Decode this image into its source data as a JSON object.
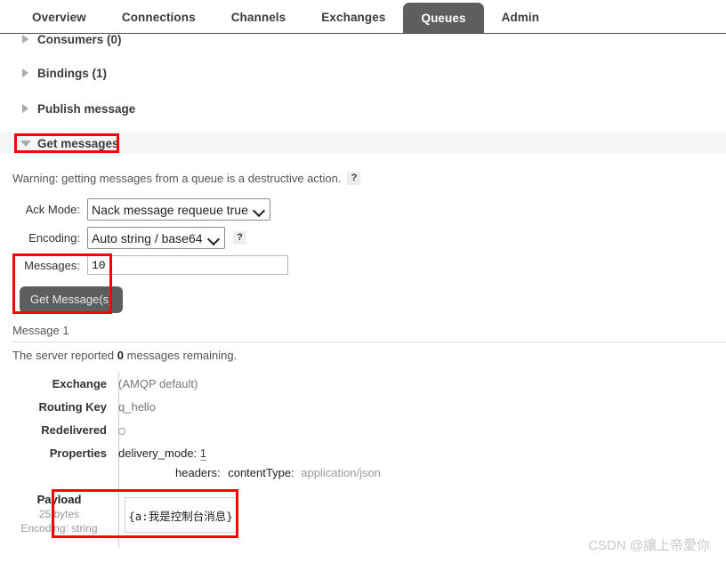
{
  "nav": {
    "tabs": [
      {
        "label": "Overview",
        "active": false
      },
      {
        "label": "Connections",
        "active": false
      },
      {
        "label": "Channels",
        "active": false
      },
      {
        "label": "Exchanges",
        "active": false
      },
      {
        "label": "Queues",
        "active": true
      },
      {
        "label": "Admin",
        "active": false
      }
    ],
    "active_tab_bg": "#5e5e5e"
  },
  "sections": [
    {
      "label": "Consumers (0)",
      "expanded": false
    },
    {
      "label": "Bindings (1)",
      "expanded": false
    },
    {
      "label": "Publish message",
      "expanded": false
    },
    {
      "label": "Get messages",
      "expanded": true
    }
  ],
  "get_messages": {
    "warning_text": "Warning: getting messages from a queue is a destructive action.",
    "warning_help": "?",
    "ack_mode_label": "Ack Mode:",
    "ack_mode_value": "Nack message requeue true",
    "encoding_label": "Encoding:",
    "encoding_value": "Auto string / base64",
    "encoding_help": "?",
    "messages_label": "Messages:",
    "messages_value": "10",
    "get_button_label": "Get Message(s)"
  },
  "message": {
    "title": "Message 1",
    "reported_prefix": "The server reported ",
    "reported_count": "0",
    "reported_suffix": " messages remaining.",
    "rows": [
      {
        "key": "Exchange",
        "value": "(AMQP default)"
      },
      {
        "key": "Routing Key",
        "value": "q_hello"
      },
      {
        "key": "Redelivered",
        "value": ""
      }
    ],
    "properties_key": "Properties",
    "properties": {
      "delivery_mode_key": "delivery_mode:",
      "delivery_mode_value": "1",
      "headers_key": "headers:",
      "content_type_key": "contentType:",
      "content_type_value": "application/json"
    },
    "payload": {
      "title": "Payload",
      "size": "25 bytes",
      "encoding": "Encoding: string",
      "body": "{a:我是控制台消息}"
    }
  },
  "annotations": {
    "highlight_color": "#fe0000"
  },
  "watermark": "CSDN @讓上帝愛你"
}
